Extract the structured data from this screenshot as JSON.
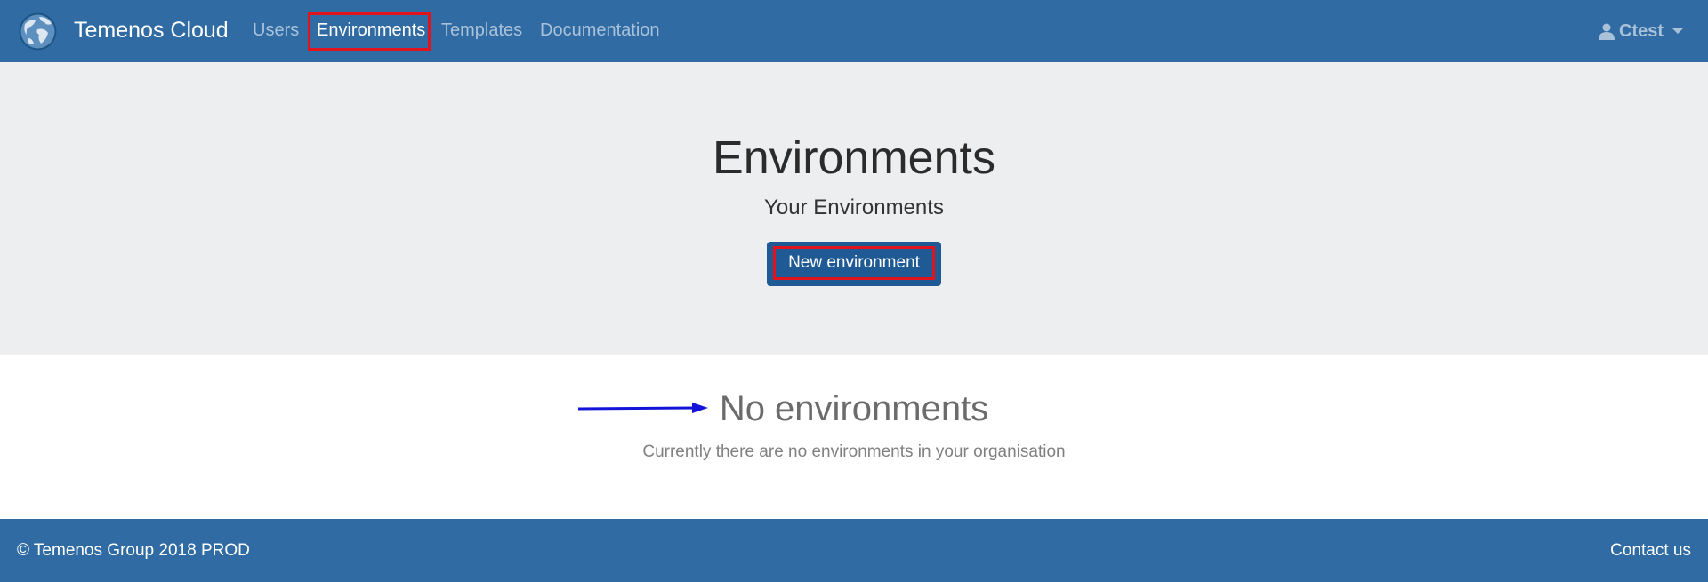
{
  "navbar": {
    "brand": "Temenos Cloud",
    "logo_icon": "globe-icon",
    "items": [
      {
        "label": "Users"
      },
      {
        "label": "Environments",
        "active": true
      },
      {
        "label": "Templates"
      },
      {
        "label": "Documentation"
      }
    ],
    "user_name": "Ctest",
    "user_icon": "user-icon"
  },
  "hero": {
    "title": "Environments",
    "subtitle": "Your Environments",
    "new_button_label": "New environment"
  },
  "empty_state": {
    "title": "No environments",
    "message": "Currently there are no environments in your organisation"
  },
  "footer": {
    "copyright": "© Temenos Group 2018 PROD",
    "contact_label": "Contact us"
  },
  "colors": {
    "navbar_bg": "#306ca3",
    "hero_bg": "#eceef0",
    "button_bg": "#1f5a95",
    "highlight_border": "#e1141e",
    "annotation_arrow": "#1414d8"
  }
}
